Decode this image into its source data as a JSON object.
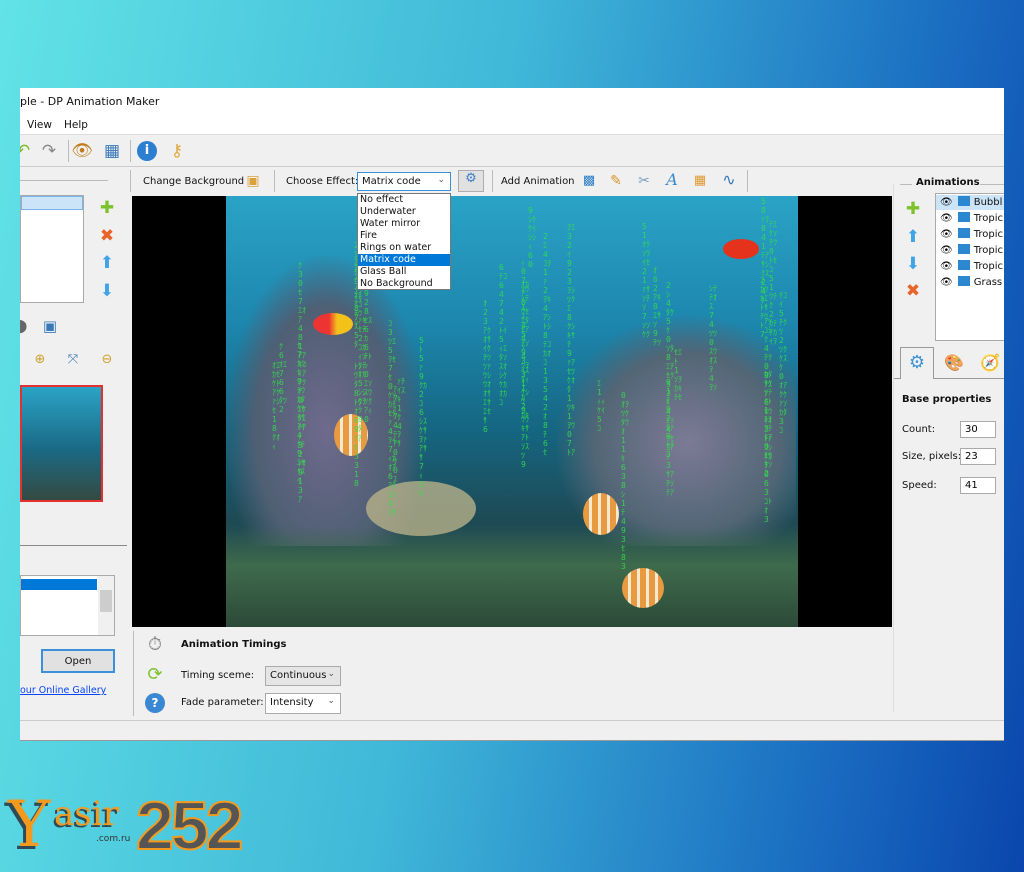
{
  "window": {
    "title": "ple - DP Animation Maker"
  },
  "menu": {
    "items": [
      "View",
      "Help"
    ]
  },
  "toolbar2": {
    "change_background": "Change Background",
    "choose_effect_label": "Choose Effect:",
    "effect_value": "Matrix code",
    "add_animation": "Add Animation"
  },
  "effect_options": [
    "No effect",
    "Underwater",
    "Water mirror",
    "Fire",
    "Rings on water",
    "Matrix code",
    "Glass Ball",
    "No Background"
  ],
  "selected_effect_index": 5,
  "left": {
    "open_label": "Open",
    "gallery_link": "our Online Gallery"
  },
  "timings": {
    "title": "Animation Timings",
    "timing_label": "Timing sceme:",
    "timing_value": "Continuous",
    "fade_label": "Fade parameter:",
    "fade_value": "Intensity"
  },
  "animations": {
    "title": "Animations",
    "items": [
      "Bubbl",
      "Tropic",
      "Tropic",
      "Tropic",
      "Tropic",
      "Grass"
    ]
  },
  "properties": {
    "title": "Base properties",
    "count_label": "Count:",
    "count": "30",
    "size_label": "Size, pixels:",
    "size": "23",
    "speed_label": "Speed:",
    "speed": "41"
  },
  "watermark": {
    "text": "Yasir252",
    "sub": ".com.ru"
  },
  "colors": {
    "accent": "#0078d7",
    "link": "#0645ff",
    "matrix": "#33e04a",
    "thumb_border": "#e53030"
  }
}
